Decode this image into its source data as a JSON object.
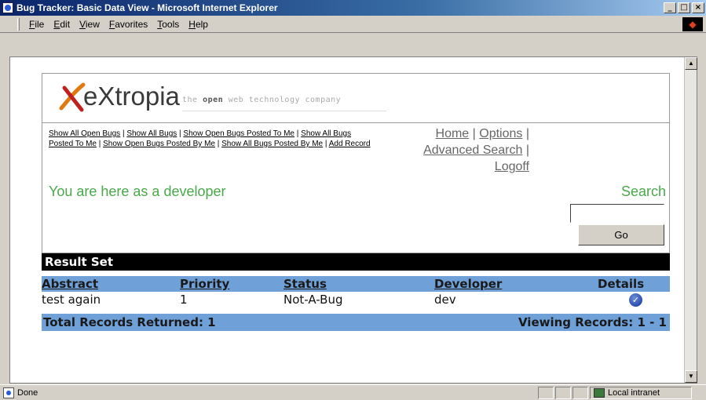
{
  "window": {
    "title": "Bug Tracker: Basic Data View - Microsoft Internet Explorer",
    "minimize": "_",
    "maximize": "□",
    "close": "×"
  },
  "menu": {
    "items": [
      "File",
      "Edit",
      "View",
      "Favorites",
      "Tools",
      "Help"
    ]
  },
  "logo": {
    "name": "eXtropia",
    "tagline_bold": "open",
    "tagline_pre": "the ",
    "tagline_post": " web technology company"
  },
  "links": [
    "Show All Open Bugs",
    "Show All Bugs",
    "Show Open Bugs Posted To Me",
    "Show All Bugs Posted To Me",
    "Show Open Bugs Posted By Me",
    "Show All Bugs Posted By Me",
    "Add Record"
  ],
  "nav": {
    "home": "Home",
    "options": "Options",
    "advanced_search": "Advanced Search",
    "logoff": "Logoff"
  },
  "here_text": "You are here as a developer",
  "search": {
    "label": "Search",
    "value": "",
    "button": "Go"
  },
  "results": {
    "header": "Result Set",
    "columns": [
      "Abstract",
      "Priority",
      "Status",
      "Developer",
      "Details"
    ],
    "rows": [
      {
        "abstract": "test again",
        "priority": "1",
        "status": "Not-A-Bug",
        "developer": "dev",
        "details_icon": "details-icon"
      }
    ],
    "total": "Total Records Returned: 1",
    "viewing": "Viewing Records: 1 - 1"
  },
  "status": {
    "text": "Done",
    "zone": "Local intranet"
  },
  "colors": {
    "accent_green": "#49a849",
    "table_blue": "#6fa0d8"
  }
}
